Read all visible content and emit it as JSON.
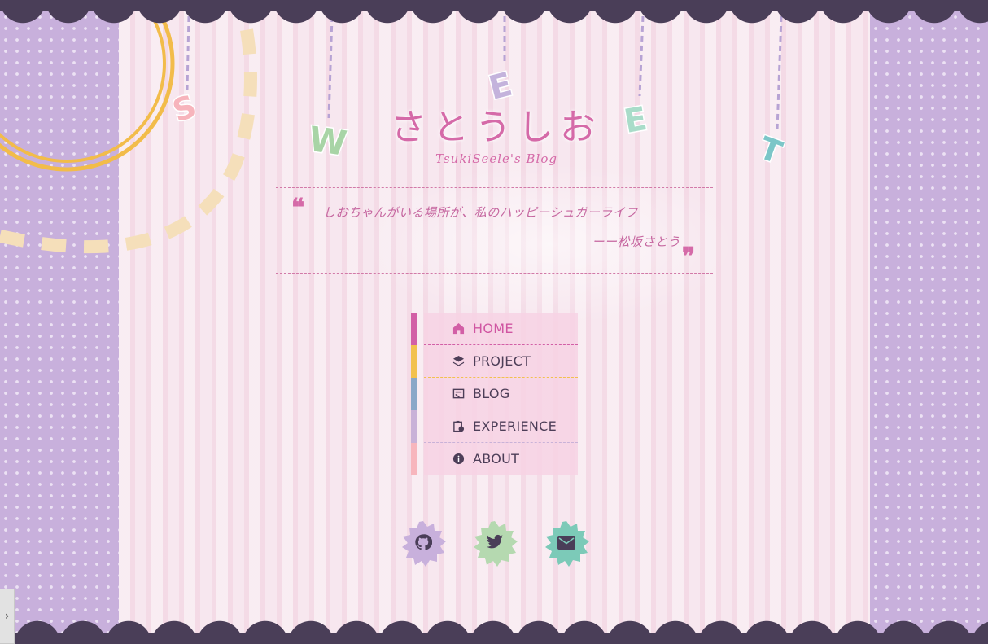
{
  "header": {
    "title": "さとうしお",
    "subtitle": "TsukiSeele's Blog",
    "hanging_letters": [
      "S",
      "W",
      "E",
      "E",
      "T"
    ]
  },
  "quote": {
    "open_mark": "❝",
    "close_mark": "❞",
    "text": "しおちゃんがいる場所が、私のハッピーシュガーライフ",
    "author": "ーー松坂さとう"
  },
  "nav": {
    "items": [
      {
        "label": "HOME",
        "icon": "home-icon",
        "color": "#d25fa6"
      },
      {
        "label": "PROJECT",
        "icon": "layers-icon",
        "color": "#f2c14e"
      },
      {
        "label": "BLOG",
        "icon": "blog-icon",
        "color": "#8aa8c8"
      },
      {
        "label": "EXPERIENCE",
        "icon": "clipboard-clock-icon",
        "color": "#c9b2d8"
      },
      {
        "label": "ABOUT",
        "icon": "info-icon",
        "color": "#f7b6bd"
      }
    ]
  },
  "socials": [
    {
      "name": "github",
      "icon": "github-icon",
      "color": "#c8b0dc"
    },
    {
      "name": "twitter",
      "icon": "twitter-icon",
      "color": "#b5d9b0"
    },
    {
      "name": "email",
      "icon": "mail-icon",
      "color": "#7ccab8"
    }
  ],
  "sidebar_toggle": {
    "label": "›"
  },
  "colors": {
    "accent": "#d56aa8",
    "dark": "#4a3e58",
    "side_pattern": "#c8b0dc",
    "background": "#f6e3ec"
  }
}
